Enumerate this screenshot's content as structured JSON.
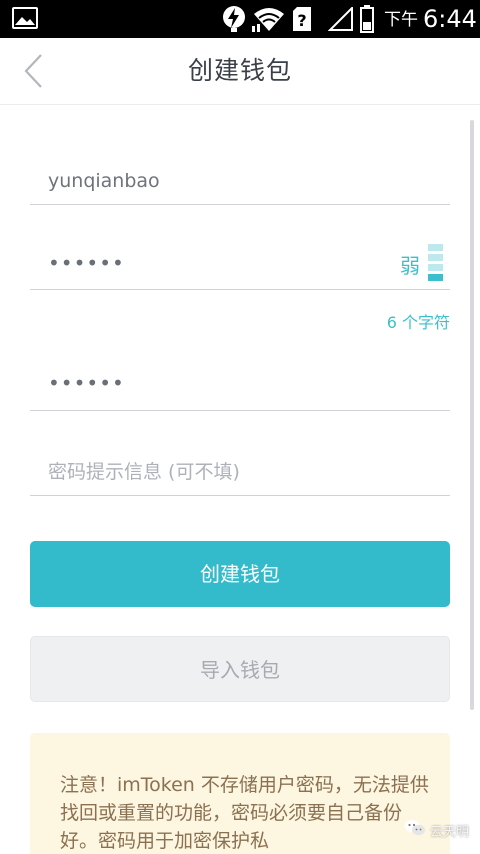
{
  "status_bar": {
    "ampm": "下午",
    "time": "6:44",
    "icons": [
      "gallery-icon",
      "flash-icon",
      "wifi-icon",
      "sim-unknown-icon",
      "signal-icon",
      "battery-icon"
    ]
  },
  "header": {
    "title": "创建钱包"
  },
  "form": {
    "wallet_name": "yunqianbao",
    "password_mask": "••••••",
    "strength_label": "弱",
    "strength_level": 0.25,
    "char_count": "6 个字符",
    "confirm_mask": "••••••",
    "hint_placeholder": "密码提示信息 (可不填)"
  },
  "actions": {
    "create_label": "创建钱包",
    "import_label": "导入钱包"
  },
  "notice": {
    "text": "注意！imToken 不存储用户密码，无法提供找回或重置的功能，密码必须要自己备份好。密码用于加密保护私"
  },
  "watermark": {
    "text": "云天明"
  },
  "colors": {
    "accent": "#34bbcb",
    "notice_bg": "#fdf6e0",
    "notice_text": "#8b7152"
  }
}
